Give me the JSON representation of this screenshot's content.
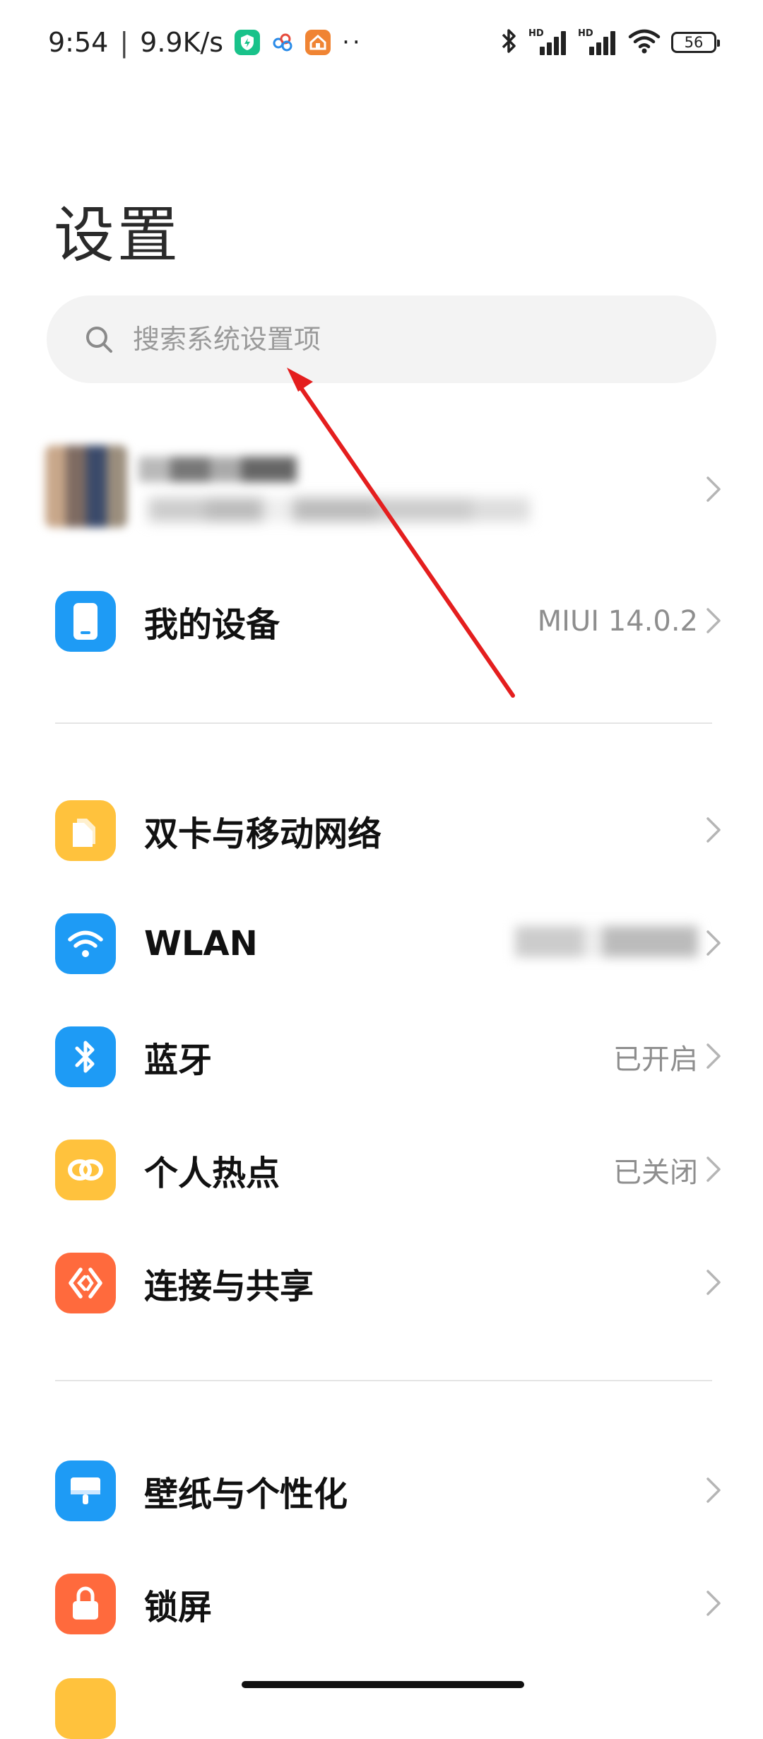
{
  "status_bar": {
    "time": "9:54",
    "separator": "|",
    "net_speed": "9.9K/s",
    "more": "··",
    "battery": "56",
    "app_icons": [
      "shield-app-icon",
      "cloud-app-icon",
      "home-app-icon"
    ],
    "hd_label": "HD"
  },
  "title": "设置",
  "search": {
    "placeholder": "搜索系统设置项"
  },
  "account": {
    "name": "",
    "subtitle": ""
  },
  "items": [
    {
      "label": "我的设备",
      "value": "MIUI 14.0.2",
      "icon": "phone-icon",
      "color": "#1e9bf5"
    },
    {
      "label": "双卡与移动网络",
      "value": "",
      "icon": "sim-card-icon",
      "color": "#ffc23d"
    },
    {
      "label": "WLAN",
      "value": "",
      "icon": "wifi-icon",
      "color": "#1e9bf5"
    },
    {
      "label": "蓝牙",
      "value": "已开启",
      "icon": "bluetooth-icon",
      "color": "#1e9bf5"
    },
    {
      "label": "个人热点",
      "value": "已关闭",
      "icon": "hotspot-icon",
      "color": "#ffc23d"
    },
    {
      "label": "连接与共享",
      "value": "",
      "icon": "share-icon",
      "color": "#ff6a3d"
    },
    {
      "label": "壁纸与个性化",
      "value": "",
      "icon": "wallpaper-icon",
      "color": "#1e9bf5"
    },
    {
      "label": "锁屏",
      "value": "",
      "icon": "lock-icon",
      "color": "#ff6a3d"
    }
  ],
  "annotation_color": "#e41e1e"
}
